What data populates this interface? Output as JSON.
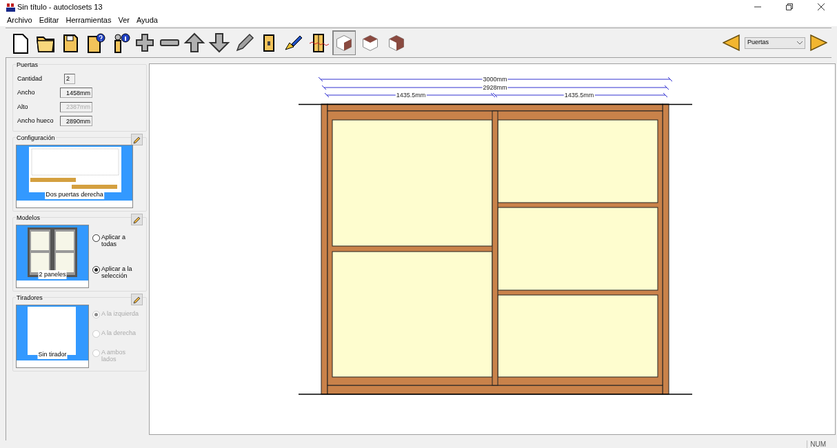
{
  "window": {
    "title": "Sin título - autoclosets 13"
  },
  "menu": [
    "Archivo",
    "Editar",
    "Herramientas",
    "Ver",
    "Ayuda"
  ],
  "view_buttons": [
    {
      "selected": true
    },
    {
      "selected": false
    },
    {
      "selected": false
    }
  ],
  "selector": {
    "value": "Puertas"
  },
  "puertas": {
    "title": "Puertas",
    "fields": [
      {
        "label": "Cantidad",
        "value": "2",
        "disabled": false,
        "kind": "short"
      },
      {
        "label": "Ancho",
        "value": "1458mm",
        "disabled": false,
        "kind": "long"
      },
      {
        "label": "Alto",
        "value": "2387mm",
        "disabled": true,
        "kind": "long"
      },
      {
        "label": "Ancho hueco",
        "value": "2890mm",
        "disabled": false,
        "kind": "long"
      }
    ]
  },
  "configuracion": {
    "title": "Configuración",
    "caption": "Dos puertas derecha"
  },
  "modelos": {
    "title": "Modelos",
    "caption": "2 paneles",
    "options": [
      {
        "label": "Aplicar a todas",
        "selected": false,
        "disabled": false
      },
      {
        "label": "Aplicar a la selección",
        "selected": true,
        "disabled": false
      }
    ]
  },
  "tiradores": {
    "title": "Tiradores",
    "caption": "Sin tirador",
    "options": [
      {
        "label": "A la izquierda",
        "selected": true,
        "disabled": true
      },
      {
        "label": "A la derecha",
        "selected": false,
        "disabled": true
      },
      {
        "label": "A ambos lados",
        "selected": false,
        "disabled": true
      }
    ]
  },
  "dimensions": {
    "total": "3000mm",
    "inner": "2928mm",
    "left_door": "1435.5mm",
    "right_door": "1435.5mm"
  },
  "status_bar": {
    "num": "NUM"
  }
}
